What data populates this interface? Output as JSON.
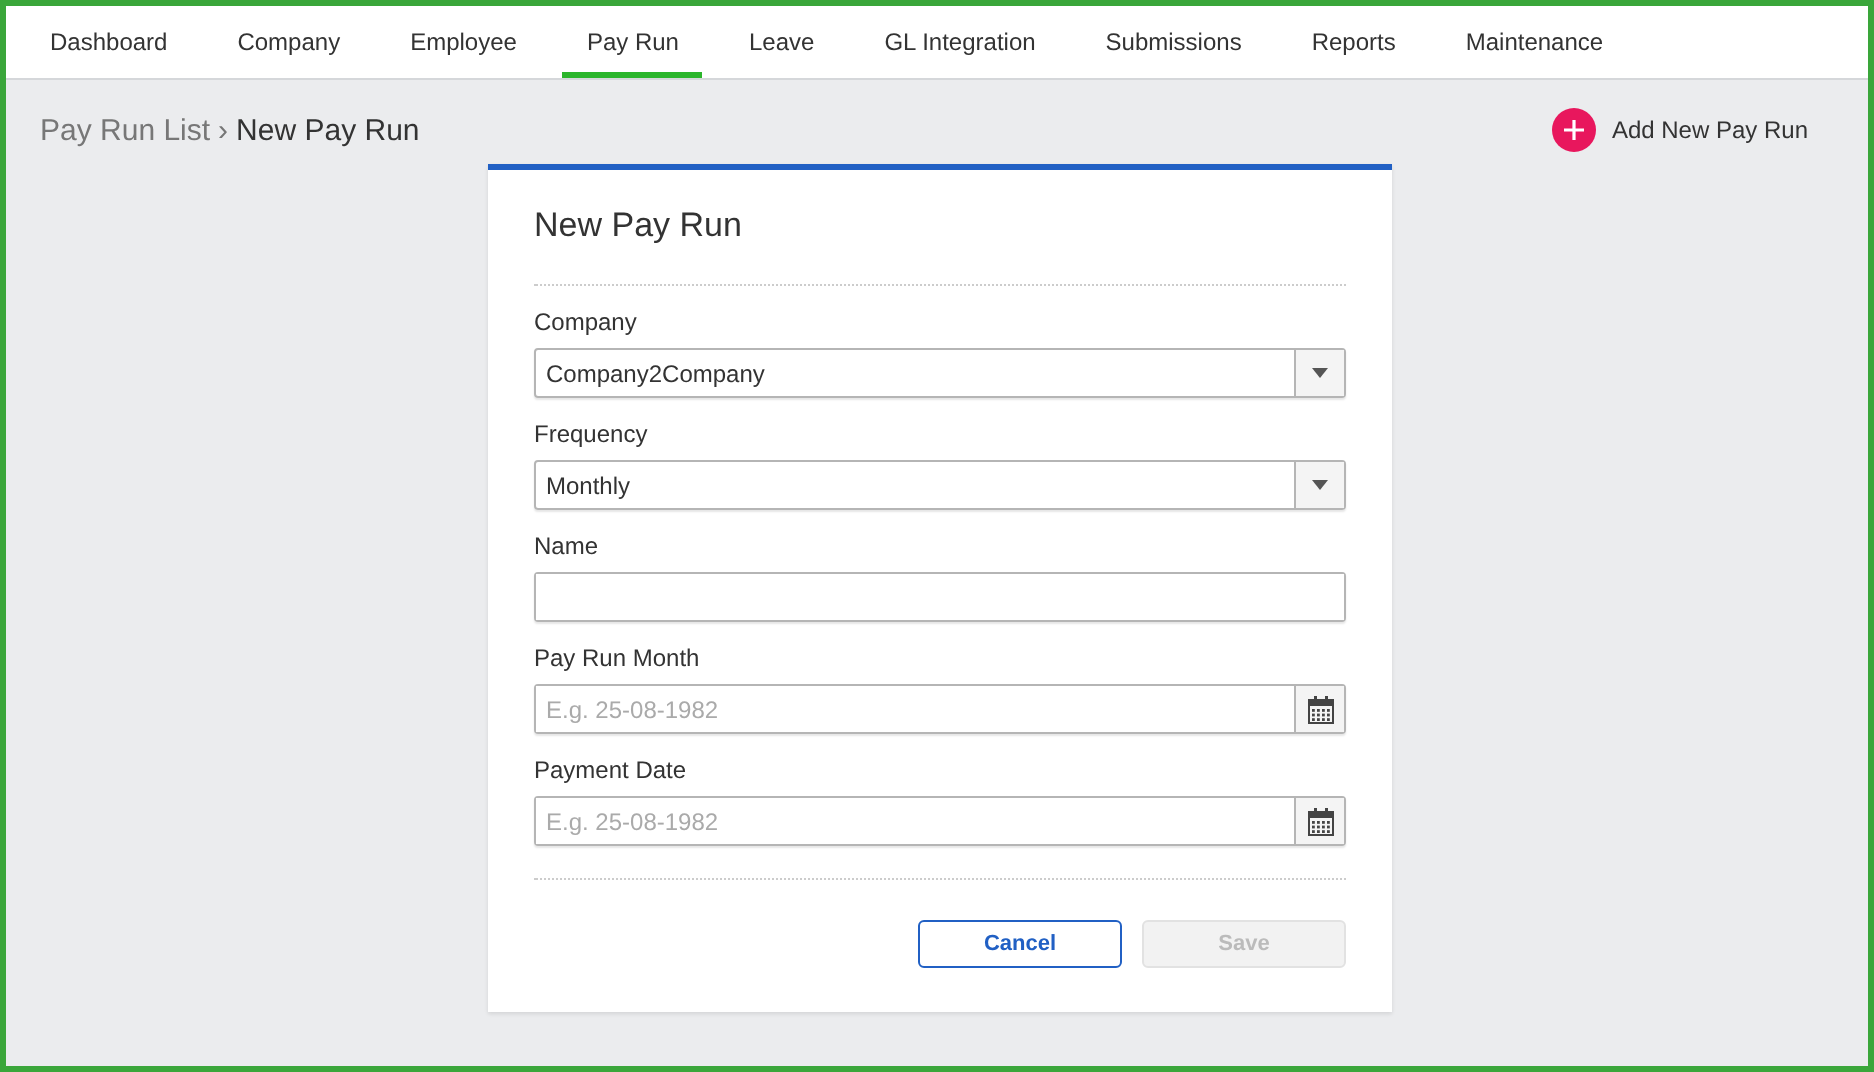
{
  "nav": [
    {
      "label": "Dashboard",
      "selected": false
    },
    {
      "label": "Company",
      "selected": false
    },
    {
      "label": "Employee",
      "selected": false
    },
    {
      "label": "Pay Run",
      "selected": true
    },
    {
      "label": "Leave",
      "selected": false
    },
    {
      "label": "GL Integration",
      "selected": false
    },
    {
      "label": "Submissions",
      "selected": false
    },
    {
      "label": "Reports",
      "selected": false
    },
    {
      "label": "Maintenance",
      "selected": false
    }
  ],
  "breadcrumb": {
    "parent": "Pay Run List",
    "separator": "›",
    "current": "New Pay Run"
  },
  "add_button": {
    "label": "Add New Pay Run"
  },
  "form": {
    "title": "New Pay Run",
    "fields": [
      {
        "kind": "select",
        "label": "Company",
        "value": "Company2Company"
      },
      {
        "kind": "select",
        "label": "Frequency",
        "value": "Monthly"
      },
      {
        "kind": "text",
        "label": "Name"
      },
      {
        "kind": "date",
        "label": "Pay Run Month",
        "placeholder": "E.g. 25-08-1982"
      },
      {
        "kind": "date",
        "label": "Payment Date",
        "placeholder": "E.g. 25-08-1982"
      }
    ],
    "buttons": [
      {
        "kind": "outline",
        "label": "Cancel",
        "disabled": false
      },
      {
        "kind": "primary",
        "label": "Save",
        "disabled": true
      }
    ]
  }
}
